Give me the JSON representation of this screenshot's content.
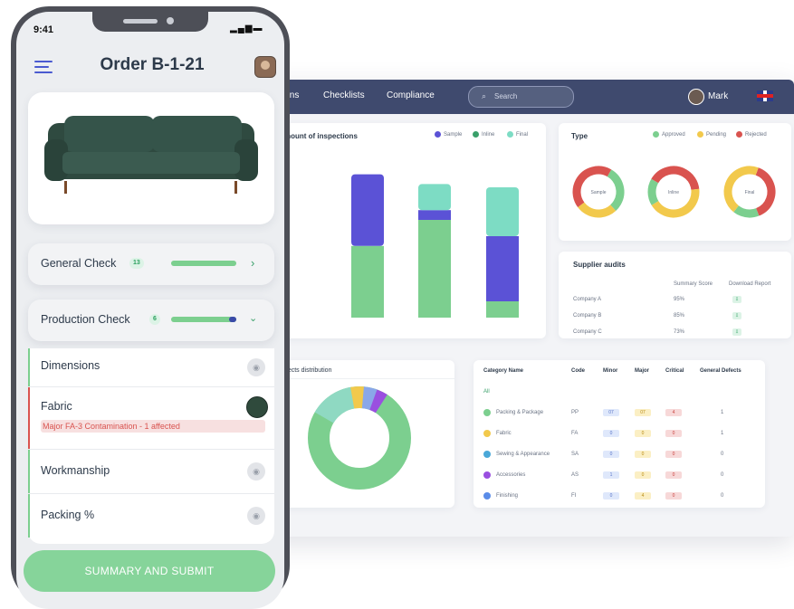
{
  "phone": {
    "status": {
      "time": "9:41"
    },
    "header": {
      "title": "Order B-1-21"
    },
    "checks": [
      {
        "label": "General Check",
        "count": "13",
        "progress": 1.0
      },
      {
        "label": "Production Check",
        "count": "6",
        "progress": 0.88
      }
    ],
    "items": [
      {
        "label": "Dimensions"
      },
      {
        "label": "Fabric",
        "alert": "Major FA-3 Contamination - 1 affected"
      },
      {
        "label": "Workmanship"
      },
      {
        "label": "Packing %"
      }
    ],
    "submit_label": "SUMMARY AND SUBMIT"
  },
  "dashboard": {
    "nav": [
      "ions",
      "Checklists",
      "Compliance"
    ],
    "search_placeholder": "Search",
    "user_name": "Mark",
    "bar_panel": {
      "title": "mount of inspections",
      "legend": [
        "Sample",
        "Inline",
        "Final"
      ]
    },
    "type_panel": {
      "title": "Type",
      "legend": [
        "Approved",
        "Pending",
        "Rejected"
      ],
      "donuts": [
        "Sample",
        "Inline",
        "Final"
      ]
    },
    "supplier_panel": {
      "title": "Supplier audits",
      "headers": [
        "Summary Score",
        "Download Report"
      ],
      "rows": [
        {
          "company": "Company A",
          "score": "95%"
        },
        {
          "company": "Company B",
          "score": "85%"
        },
        {
          "company": "Company C",
          "score": "73%"
        }
      ]
    },
    "defects_panel": {
      "title": "efects distribution"
    },
    "category_table": {
      "headers": [
        "Category Name",
        "Code",
        "Minor",
        "Major",
        "Critical",
        "General Defects"
      ],
      "all_label": "All",
      "rows": [
        {
          "name": "Packing & Package",
          "code": "PP",
          "minor": "07",
          "major": "07",
          "critical": "4",
          "general": "1"
        },
        {
          "name": "Fabric",
          "code": "FA",
          "minor": "0",
          "major": "0",
          "critical": "0",
          "general": "1"
        },
        {
          "name": "Sewing & Appearance",
          "code": "SA",
          "minor": "0",
          "major": "0",
          "critical": "0",
          "general": "0"
        },
        {
          "name": "Accessories",
          "code": "AS",
          "minor": "1",
          "major": "0",
          "critical": "0",
          "general": "0"
        },
        {
          "name": "Finishing",
          "code": "FI",
          "minor": "0",
          "major": "4",
          "critical": "0",
          "general": "0"
        }
      ]
    }
  },
  "colors": {
    "accent_green": "#86d49a",
    "indigo": "#5b52d6",
    "teal": "#7ddcc4",
    "red": "#d9534f",
    "yellow": "#f2c94c",
    "navbar": "#3f4a6e"
  },
  "chart_data": {
    "type": "bar",
    "stacked": true,
    "categories": [
      "",
      "",
      "",
      ""
    ],
    "series": [
      {
        "name": "Sample",
        "values": [
          7,
          22,
          30,
          5
        ]
      },
      {
        "name": "Inline",
        "values": [
          0,
          22,
          3,
          20
        ]
      },
      {
        "name": "Final",
        "values": [
          0,
          0,
          8,
          15
        ]
      }
    ],
    "title": "mount of inspections",
    "legend": "top-right"
  }
}
